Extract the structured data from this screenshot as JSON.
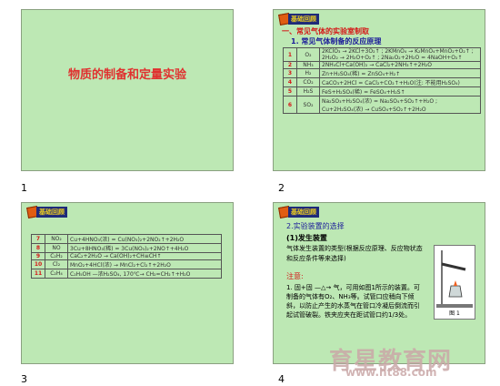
{
  "slide1": {
    "number": "1",
    "title": "物质的制备和定量实验"
  },
  "slide2": {
    "number": "2",
    "badge": "基础回顾",
    "heading": "一、常见气体的实验室制取",
    "subheading": "1. 常见气体制备的反应原理",
    "rows": [
      {
        "idx": "1",
        "gas": "O₂",
        "eq": "2KClO₃ → 2KCl+3O₂↑ ; 2KMnO₄ → K₂MnO₄+MnO₂+O₂↑ ; 2H₂O₂ → 2H₂O+O₂↑ ; 2Na₂O₂+2H₂O = 4NaOH+O₂↑"
      },
      {
        "idx": "2",
        "gas": "NH₃",
        "eq": "2NH₄Cl+Ca(OH)₂ → CaCl₂+2NH₃↑+2H₂O"
      },
      {
        "idx": "3",
        "gas": "H₂",
        "eq": "Zn+H₂SO₄(稀) = ZnSO₄+H₂↑"
      },
      {
        "idx": "4",
        "gas": "CO₂",
        "eq": "CaCO₃+2HCl = CaCl₂+CO₂↑+H₂O(注: 不能用H₂SO₄)"
      },
      {
        "idx": "5",
        "gas": "H₂S",
        "eq": "FeS+H₂SO₄(稀) = FeSO₄+H₂S↑"
      },
      {
        "idx": "6",
        "gas": "SO₂",
        "eq": "Na₂SO₃+H₂SO₄(浓) = Na₂SO₄+SO₂↑+H₂O ; Cu+2H₂SO₄(浓) → CuSO₄+SO₂↑+2H₂O"
      }
    ]
  },
  "slide3": {
    "number": "3",
    "badge": "基础回顾",
    "rows": [
      {
        "idx": "7",
        "gas": "NO₂",
        "eq": "Cu+4HNO₃(浓) = Cu(NO₃)₂+2NO₂↑+2H₂O"
      },
      {
        "idx": "8",
        "gas": "NO",
        "eq": "3Cu+8HNO₃(稀) = 3Cu(NO₃)₂+2NO↑+4H₂O"
      },
      {
        "idx": "9",
        "gas": "C₂H₂",
        "eq": "CaC₂+2H₂O → Ca(OH)₂+CH≡CH↑"
      },
      {
        "idx": "10",
        "gas": "Cl₂",
        "eq": "MnO₂+4HCl(浓) → MnCl₂+Cl₂↑+2H₂O"
      },
      {
        "idx": "11",
        "gas": "C₂H₄",
        "eq": "C₂H₅OH —浓H₂SO₄, 170℃→ CH₂=CH₂↑+H₂O"
      }
    ]
  },
  "slide4": {
    "number": "4",
    "badge": "基础回顾",
    "heading": "2.实验装置的选择",
    "subheading": "(1)发生装置",
    "para1": "气体发生装置的类型(根据反应原理、反应物状态和反应条件等来选择)",
    "note": "注意:",
    "para2": "1. 固+固 —△→ 气，可用如图1所示的装置。可制备的气体有O₂、NH₃等。试管口应稍向下倾斜，以防止产生的水蒸气在管口冷凝后倒流而引起试管破裂。铁夹应夹在距试管口约1/3处。",
    "figure_label": "图 1"
  },
  "watermark": {
    "line1": "育星教育网",
    "line2": "www.ht88.com"
  }
}
